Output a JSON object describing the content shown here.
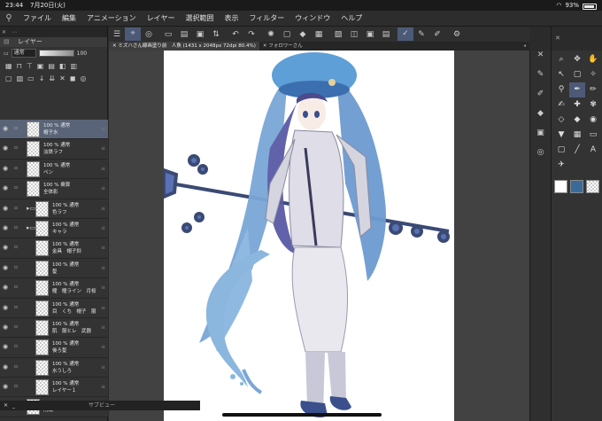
{
  "status": {
    "time": "23:44",
    "date": "7月20日(火)",
    "battery": "93%",
    "battery_level": 0.93
  },
  "menu": [
    "ファイル",
    "編集",
    "アニメーション",
    "レイヤー",
    "選択範囲",
    "表示",
    "フィルター",
    "ウィンドウ",
    "ヘルプ"
  ],
  "layer_panel": {
    "title": "レイヤー",
    "blend_mode": "通常",
    "opacity": "100",
    "layers": [
      {
        "line1": "100 % 通常",
        "line2": "帽子水",
        "selected": true,
        "folder": false,
        "indent": 0
      },
      {
        "line1": "100 % 通常",
        "line2": "淡鉄ラフ",
        "selected": false,
        "folder": false,
        "indent": 0
      },
      {
        "line1": "100 % 通常",
        "line2": "ペン",
        "selected": false,
        "folder": false,
        "indent": 0
      },
      {
        "line1": "100 % 乗算",
        "line2": "全体影",
        "selected": false,
        "folder": false,
        "indent": 0
      },
      {
        "line1": "100 % 通常",
        "line2": "色ラフ",
        "selected": false,
        "folder": true,
        "indent": 0
      },
      {
        "line1": "100 % 通常",
        "line2": "キャラ",
        "selected": false,
        "folder": true,
        "indent": 0
      },
      {
        "line1": "100 % 通常",
        "line2": "金具　帽子鈴",
        "selected": false,
        "folder": false,
        "indent": 1
      },
      {
        "line1": "100 % 通常",
        "line2": "髪",
        "selected": false,
        "folder": false,
        "indent": 1
      },
      {
        "line1": "100 % 通常",
        "line2": "瞳　瞳ライン　月桜",
        "selected": false,
        "folder": false,
        "indent": 1
      },
      {
        "line1": "100 % 通常",
        "line2": "目　くち　帽子　服",
        "selected": false,
        "folder": false,
        "indent": 1
      },
      {
        "line1": "100 % 通常",
        "line2": "肌　服ヒレ　武器",
        "selected": false,
        "folder": false,
        "indent": 1
      },
      {
        "line1": "100 % 通常",
        "line2": "後ろ髪",
        "selected": false,
        "folder": false,
        "indent": 1
      },
      {
        "line1": "100 % 通常",
        "line2": "水うしろ",
        "selected": false,
        "folder": false,
        "indent": 1
      },
      {
        "line1": "100 % 通常",
        "line2": "レイヤー１",
        "selected": false,
        "folder": false,
        "indent": 1
      },
      {
        "line1": "",
        "line2": "用紙",
        "selected": false,
        "folder": false,
        "indent": 0
      }
    ]
  },
  "canvas_tabs": [
    {
      "label": "ミズハさん線画塗り前　人魚 (1431 x 2048px 72dpi 80.4%)",
      "active": true
    },
    {
      "label": "フォロワーさん",
      "active": false
    }
  ],
  "subview": {
    "label": "サブビュー"
  },
  "colors": {
    "main": "#ffffff",
    "sub": "#3a6a9a",
    "accent": "#4c5a78"
  }
}
